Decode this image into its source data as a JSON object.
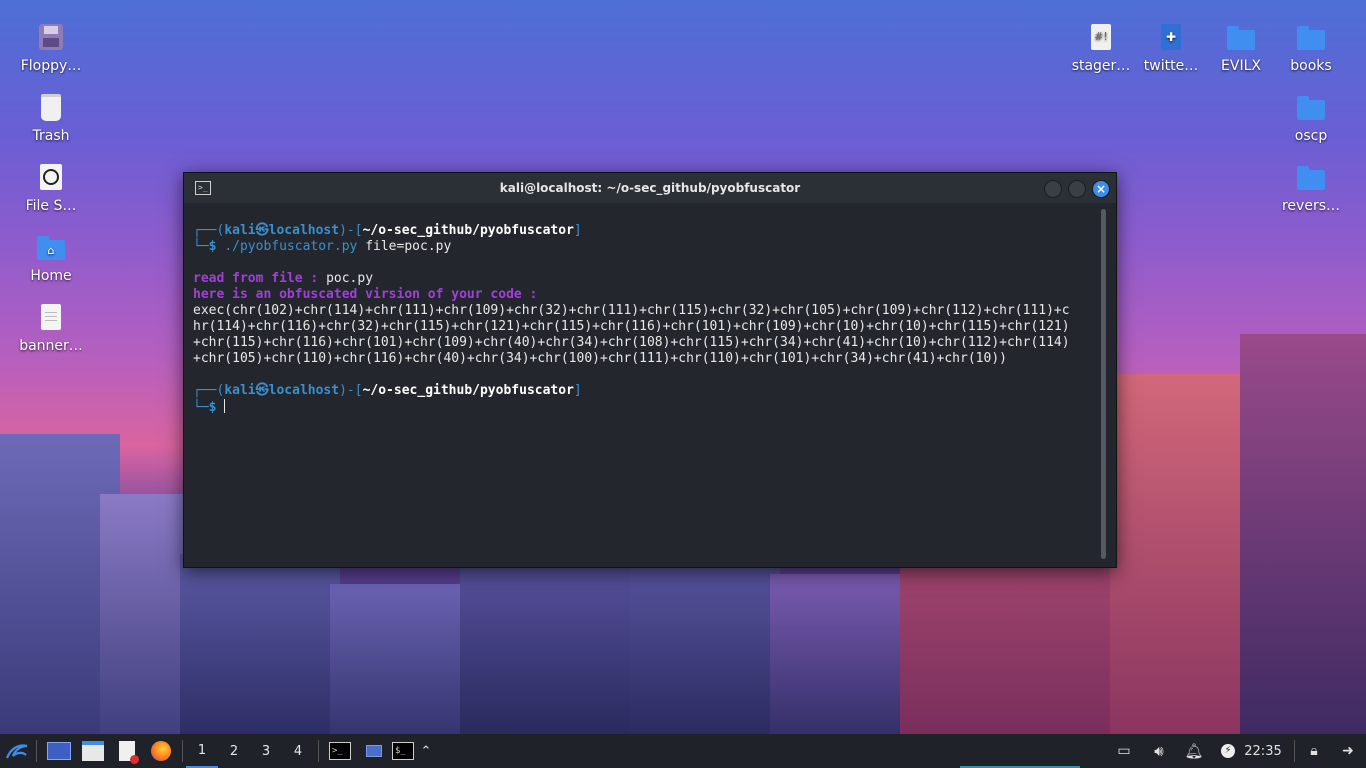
{
  "desktop": {
    "left_icons": [
      {
        "label": "Floppy…",
        "icon": "floppy-icon"
      },
      {
        "label": "Trash",
        "icon": "trash-icon"
      },
      {
        "label": "File S…",
        "icon": "file-system-icon"
      },
      {
        "label": "Home",
        "icon": "home-folder-icon"
      },
      {
        "label": "banner…",
        "icon": "text-file-icon"
      }
    ],
    "right_icons": [
      {
        "label": "stager…",
        "icon": "script-file-icon"
      },
      {
        "label": "twitte…",
        "icon": "python-file-icon"
      },
      {
        "label": "EVILX",
        "icon": "folder-icon"
      },
      {
        "label": "books",
        "icon": "folder-icon"
      },
      {
        "label": "oscp",
        "icon": "folder-icon"
      },
      {
        "label": "revers…",
        "icon": "folder-icon"
      }
    ]
  },
  "terminal": {
    "title": "kali@localhost: ~/o-sec_github/pyobfuscator",
    "prompt1": {
      "frame_open": "┌──(",
      "user": "kali",
      "at": "㉿",
      "host": "localhost",
      "mid": ")-[",
      "path": "~/o-sec_github/pyobfuscator",
      "frame_close": "]",
      "second_line_prefix": "└─",
      "dollar": "$",
      "command": "./pyobfuscator.py",
      "args": "file=poc.py"
    },
    "out_read_label": "read from file :",
    "out_read_value": "poc.py",
    "out_here": "here is an obfuscated virsion of your code :",
    "out_code": [
      "exec(chr(102)+chr(114)+chr(111)+chr(109)+chr(32)+chr(111)+chr(115)+chr(32)+chr(105)+chr(109)+chr(112)+chr(111)+c",
      "hr(114)+chr(116)+chr(32)+chr(115)+chr(121)+chr(115)+chr(116)+chr(101)+chr(109)+chr(10)+chr(10)+chr(115)+chr(121)",
      "+chr(115)+chr(116)+chr(101)+chr(109)+chr(40)+chr(34)+chr(108)+chr(115)+chr(34)+chr(41)+chr(10)+chr(112)+chr(114)",
      "+chr(105)+chr(110)+chr(116)+chr(40)+chr(34)+chr(100)+chr(111)+chr(110)+chr(101)+chr(34)+chr(41)+chr(10))"
    ],
    "prompt2": {
      "frame_open": "┌──(",
      "user": "kali",
      "at": "㉿",
      "host": "localhost",
      "mid": ")-[",
      "path": "~/o-sec_github/pyobfuscator",
      "frame_close": "]",
      "second_line_prefix": "└─",
      "dollar": "$"
    }
  },
  "taskbar": {
    "workspaces": [
      "1",
      "2",
      "3",
      "4"
    ],
    "active_workspace": "1",
    "clock": "22:35"
  },
  "colors": {
    "accent": "#3d8ee8",
    "prompt_blue": "#3a8fd0",
    "output_purple": "#a040d8",
    "terminal_bg": "#23272d"
  }
}
